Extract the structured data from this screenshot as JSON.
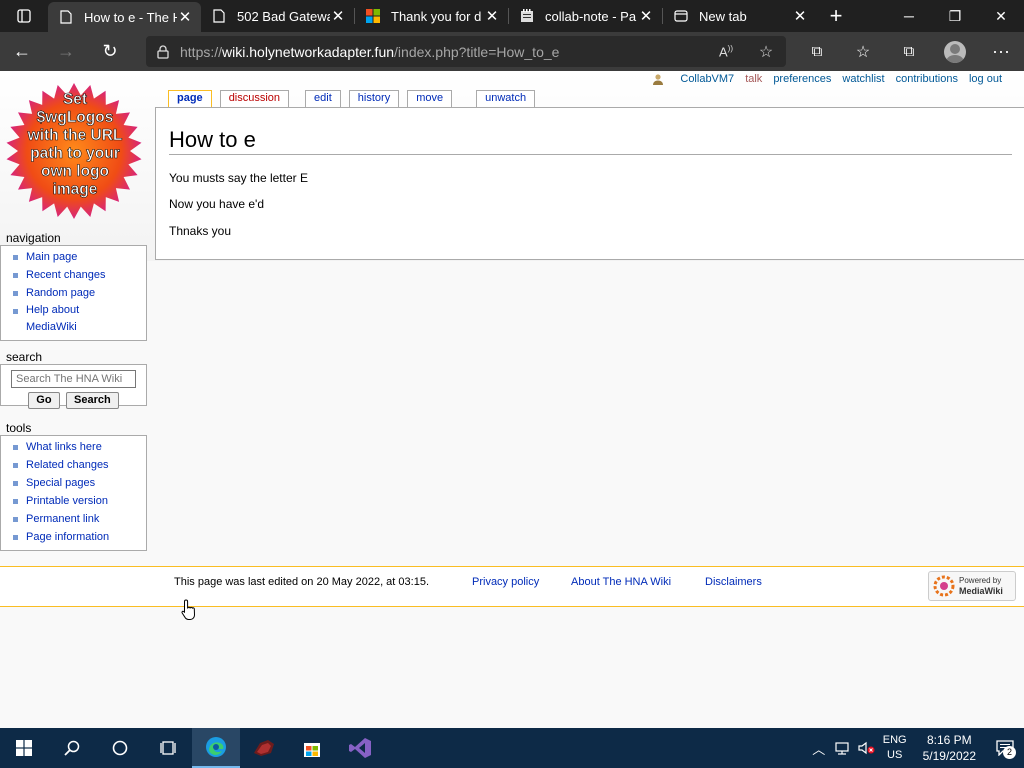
{
  "browser": {
    "tabs": [
      {
        "title": "How to e - The H",
        "icon": "page-icon",
        "active": true
      },
      {
        "title": "502 Bad Gatewa",
        "icon": "page-icon",
        "active": false
      },
      {
        "title": "Thank you for d",
        "icon": "microsoft-icon",
        "active": false
      },
      {
        "title": "collab-note - Pa",
        "icon": "notepad-icon",
        "active": false
      },
      {
        "title": "New tab",
        "icon": "newtab-icon",
        "active": false
      }
    ],
    "url": {
      "protocol": "https://",
      "host": "wiki.holynetworkadapter.fun",
      "path": "/index.php?title=How_to_e"
    }
  },
  "wiki": {
    "personal_tools": {
      "user": "CollabVM7",
      "talk": "talk",
      "preferences": "preferences",
      "watchlist": "watchlist",
      "contributions": "contributions",
      "logout": "log out"
    },
    "logo_text": [
      "Set",
      "$wgLogos",
      "with the URL",
      "path to your",
      "own logo",
      "image"
    ],
    "content_tabs": {
      "page": "page",
      "discussion": "discussion",
      "edit": "edit",
      "history": "history",
      "move": "move",
      "unwatch": "unwatch"
    },
    "page": {
      "title": "How to e",
      "paragraphs": [
        "You musts say the letter E",
        "Now you have e'd",
        "Thnaks you"
      ]
    },
    "navigation": {
      "heading": "navigation",
      "items": [
        "Main page",
        "Recent changes",
        "Random page",
        "Help about MediaWiki"
      ]
    },
    "search": {
      "heading": "search",
      "placeholder": "Search The HNA Wiki",
      "go": "Go",
      "search": "Search"
    },
    "tools": {
      "heading": "tools",
      "items": [
        "What links here",
        "Related changes",
        "Special pages",
        "Printable version",
        "Permanent link",
        "Page information"
      ]
    },
    "footer": {
      "last_edited": "This page was last edited on 20 May 2022, at 03:15.",
      "privacy": "Privacy policy",
      "about": "About The HNA Wiki",
      "disclaimers": "Disclaimers",
      "powered_small": "Powered by",
      "powered_big": "MediaWiki"
    }
  },
  "taskbar": {
    "lang_top": "ENG",
    "lang_bottom": "US",
    "time": "8:16 PM",
    "date": "5/19/2022",
    "notification_count": "2"
  }
}
